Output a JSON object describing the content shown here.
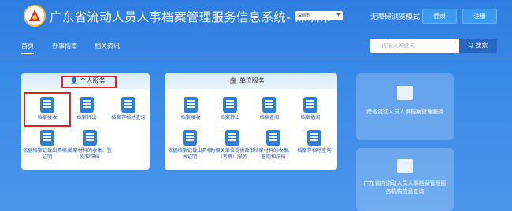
{
  "header": {
    "title": "广东省流动人员人事档案管理服务信息系统- 深圳市",
    "city_select": "深圳市",
    "accessibility": "无障碍浏览模式",
    "login": "登录",
    "register": "注册"
  },
  "nav": {
    "items": [
      "首页",
      "办事指南",
      "相关资讯"
    ],
    "search_placeholder": "请输入关键词",
    "search_button": "Q 搜索"
  },
  "personal": {
    "title": "个人服务",
    "services": [
      "档案接收",
      "档案转出",
      "档案存档地查询",
      "依据档案记载出具相关证明",
      "档案材料的收集、鉴别和归档"
    ]
  },
  "unit": {
    "title": "单位服务",
    "services": [
      "档案接收",
      "档案转出",
      "档案查阅",
      "档案借阅",
      "依据档案记载出具相关证明",
      "为相关单位提供政审（考察）服务",
      "档案材料的收集、鉴别和归档",
      "档案存档地查询"
    ]
  },
  "side": {
    "card1": "跨省流动人员人事档案管理服务",
    "card2": "广东省内流动人员人事档案管理服务机构信息查询"
  }
}
